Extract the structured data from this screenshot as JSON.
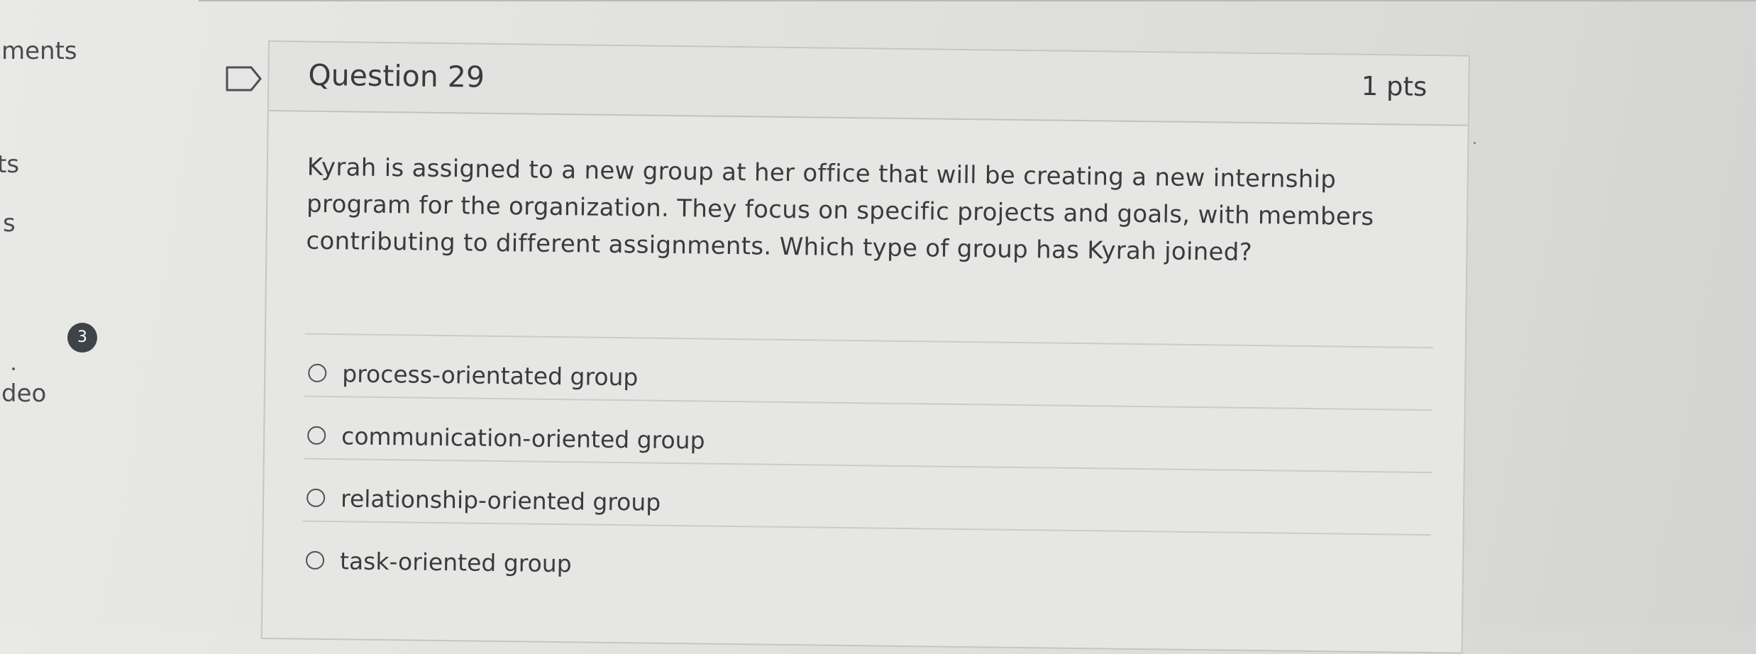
{
  "nav": {
    "items": [
      {
        "label": "ments"
      },
      {
        "label": "ts"
      },
      {
        "label": "s"
      },
      {
        "label": "deo"
      }
    ],
    "badge_count": "3"
  },
  "question": {
    "title": "Question 29",
    "points": "1 pts",
    "text": "Kyrah is assigned to a new group at her office that will be creating a new internship program for the organization. They focus on specific projects and goals, with members contributing to different assignments. Which type of group has Kyrah joined?",
    "answers": [
      {
        "label": "process-orientated group",
        "selected": false
      },
      {
        "label": "communication-oriented group",
        "selected": false
      },
      {
        "label": "relationship-oriented group",
        "selected": false
      },
      {
        "label": "task-oriented group",
        "selected": false
      }
    ]
  },
  "icons": {
    "flag": "flag-icon",
    "radio": "radio-button-icon"
  },
  "colors": {
    "text": "#3a3b3d",
    "badge": "#3e4347",
    "border": "#c5c5c3"
  }
}
